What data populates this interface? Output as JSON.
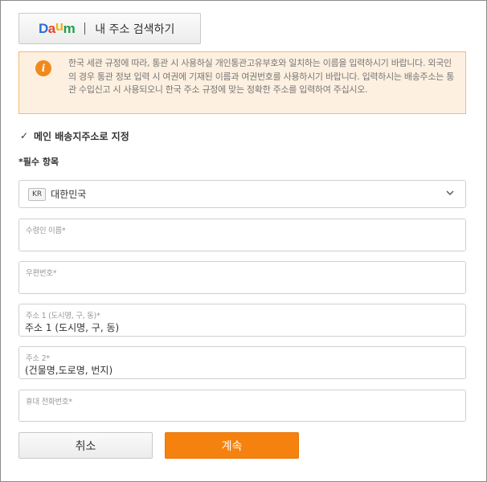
{
  "header": {
    "logo_letters": [
      "D",
      "a",
      "u",
      "m"
    ],
    "logo_colors": [
      "#2a6fd6",
      "#e8452c",
      "#f2b31a",
      "#1ea04b"
    ],
    "search_label": "내 주소 검색하기"
  },
  "notice": {
    "icon": "info-icon",
    "icon_char": "i",
    "text": "한국 세관 규정에 따라, 통관 시 사용하실 개인통관고유부호와 일치하는 이름을 입력하시기 바랍니다. 외국인의 경우 통관 정보 입력 시 여권에 기재된 이름과 여권번호를 사용하시기 바랍니다. 입력하시는 배송주소는 통관 수입신고 시 사용되오니 한국 주소 규정에 맞는 정확한 주소를 입력하여 주십시오."
  },
  "default_address": {
    "check_char": "✓",
    "label": "메인 배송지주소로 지정"
  },
  "required_title": "*필수 항목",
  "country": {
    "code": "KR",
    "name": "대한민국"
  },
  "fields": {
    "recipient": {
      "label": "수령인 이름*",
      "value": ""
    },
    "postal": {
      "label": "우편번호*",
      "value": ""
    },
    "address1": {
      "label": "주소 1 (도시명, 구, 동)*",
      "placeholder": "주소 1 (도시명, 구, 동)"
    },
    "address2": {
      "label": "주소 2*",
      "placeholder": "(건물명,도로명, 번지)"
    },
    "phone": {
      "label": "휴대 전화번호*",
      "value": ""
    }
  },
  "buttons": {
    "cancel": "취소",
    "continue": "계속"
  },
  "colors": {
    "accent": "#f5820f",
    "notice_bg": "#fdf0e0",
    "notice_border": "#f3b97a"
  }
}
